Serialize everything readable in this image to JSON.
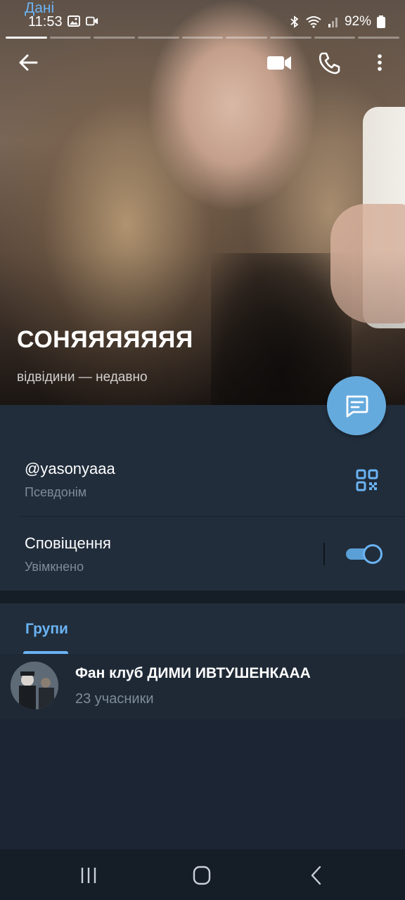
{
  "status_bar": {
    "time": "11:53",
    "battery": "92%",
    "left_icons": [
      "gallery-icon",
      "video-record-icon"
    ],
    "right_icons": [
      "bluetooth-icon",
      "wifi-icon",
      "signal-icon",
      "battery-icon"
    ]
  },
  "story": {
    "segments": 9,
    "active_index": 0
  },
  "profile": {
    "name": "СОНЯЯЯЯЯЯЯ",
    "last_seen": "відвідини — недавно"
  },
  "actions": [
    "back-arrow-icon",
    "video-call-icon",
    "phone-call-icon",
    "more-vertical-icon",
    "message-icon"
  ],
  "info": {
    "section_title": "Дані",
    "username": "@yasonyaaa",
    "username_caption": "Псевдонім",
    "notifications_title": "Сповіщення",
    "notifications_caption": "Увімкнено",
    "notifications_on": true
  },
  "groups": {
    "tab_label": "Групи",
    "items": [
      {
        "name": "Фан клуб ДИМИ ИВТУШЕНКААА",
        "members": "23 учасники"
      }
    ]
  },
  "colors": {
    "accent": "#6ab3f3",
    "fab": "#65aadd",
    "card_bg": "#212d3b",
    "page_bg": "#1c2533",
    "secondary_text": "#7f8b98"
  }
}
